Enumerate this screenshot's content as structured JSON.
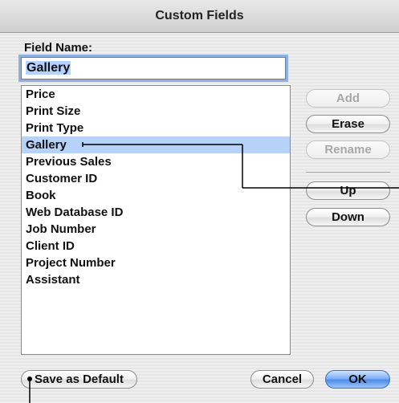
{
  "dialog": {
    "title": "Custom Fields"
  },
  "field_name": {
    "label": "Field Name:",
    "value": "Gallery"
  },
  "fields_list": {
    "items": [
      "Price",
      "Print Size",
      "Print Type",
      "Gallery",
      "Previous Sales",
      "Customer ID",
      "Book",
      "Web Database ID",
      "Job Number",
      "Client ID",
      "Project Number",
      "Assistant"
    ],
    "selected": "Gallery"
  },
  "side_buttons": {
    "add": "Add",
    "erase": "Erase",
    "rename": "Rename",
    "up": "Up",
    "down": "Down"
  },
  "footer": {
    "save_default": "Save as Default",
    "cancel": "Cancel",
    "ok": "OK"
  },
  "colors": {
    "selection": "#b7d2f8",
    "default_button": "#4d8ce6"
  }
}
